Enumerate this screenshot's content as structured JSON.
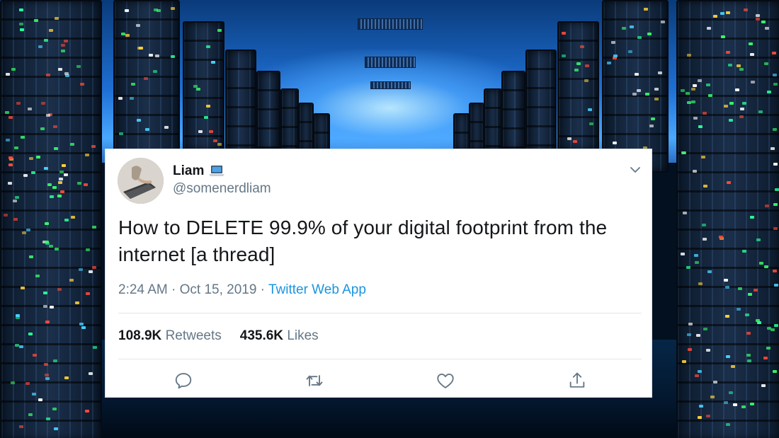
{
  "tweet": {
    "display_name": "Liam",
    "name_emoji": "laptop-icon",
    "handle": "@somenerdliam",
    "text_line1": "How to DELETE 99.9% of your digital footprint from the",
    "text_line2": "internet [a thread]",
    "time": "2:24 AM",
    "separator": " · ",
    "date": "Oct 15, 2019",
    "separator2": " · ",
    "source": "Twitter Web App",
    "retweets_count": "108.9K",
    "retweets_label": "Retweets",
    "likes_count": "435.6K",
    "likes_label": "Likes"
  },
  "icons": {
    "menu": "chevron-down-icon",
    "reply": "reply-icon",
    "retweet": "retweet-icon",
    "like": "heart-icon",
    "share": "share-icon"
  },
  "colors": {
    "link": "#1b95e0",
    "text": "#14171a",
    "muted": "#657786",
    "icon": "#657786"
  }
}
